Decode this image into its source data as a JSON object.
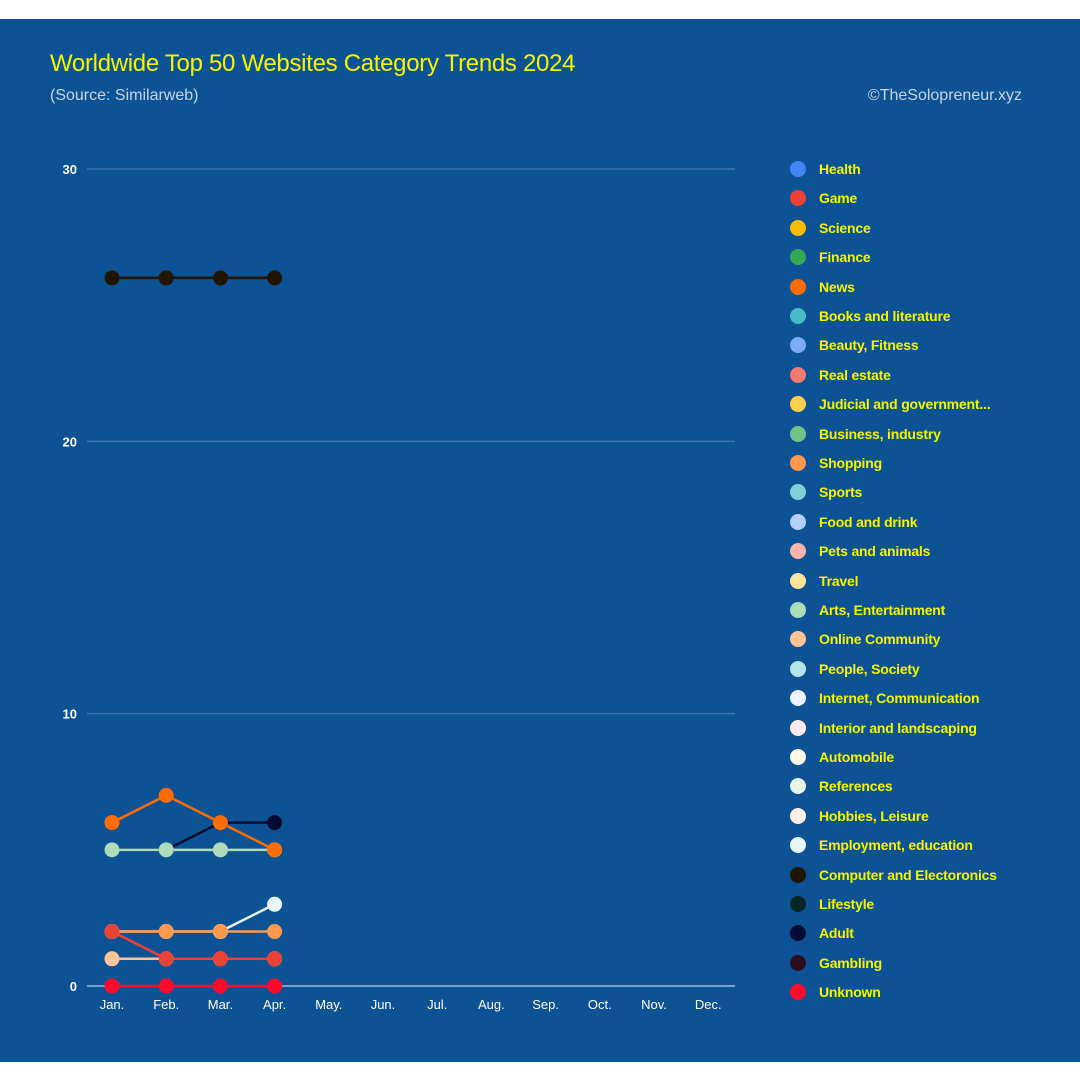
{
  "header": {
    "title": "Worldwide Top 50 Websites Category Trends 2024",
    "subtitle": "(Source: Similarweb)",
    "credit": "©TheSolopreneur.xyz"
  },
  "colors": {
    "background": "#0d5294",
    "title": "#f5f500",
    "subtitle": "#c9d6e6",
    "gridline": "#3b74ad",
    "axis": "#9fb8d6",
    "tick_label": "#ffffff"
  },
  "chart_data": {
    "type": "line",
    "title": "Worldwide Top 50 Websites Category Trends 2024",
    "subtitle": "(Source: Similarweb)",
    "xlabel": "",
    "ylabel": "",
    "x": [
      "Jan.",
      "Feb.",
      "Mar.",
      "Apr.",
      "May.",
      "Jun.",
      "Jul.",
      "Aug.",
      "Sep.",
      "Oct.",
      "Nov.",
      "Dec."
    ],
    "ylim": [
      0,
      30
    ],
    "yticks": [
      0,
      10,
      20,
      30
    ],
    "grid": true,
    "legend_position": "right",
    "series": [
      {
        "name": "Health",
        "color": "#4285f4",
        "values": []
      },
      {
        "name": "Game",
        "color": "#ea4335",
        "values": [
          2,
          1,
          1,
          1
        ]
      },
      {
        "name": "Science",
        "color": "#fbbc04",
        "values": []
      },
      {
        "name": "Finance",
        "color": "#34a853",
        "values": []
      },
      {
        "name": "News",
        "color": "#ff6d01",
        "values": [
          6,
          7,
          6,
          5
        ]
      },
      {
        "name": "Books and literature",
        "color": "#46bdc6",
        "values": []
      },
      {
        "name": "Beauty, Fitness",
        "color": "#7baaf7",
        "values": []
      },
      {
        "name": "Real estate",
        "color": "#f07b72",
        "values": []
      },
      {
        "name": "Judicial and government...",
        "color": "#fcd04f",
        "values": []
      },
      {
        "name": "Business, industry",
        "color": "#71c287",
        "values": []
      },
      {
        "name": "Shopping",
        "color": "#ff994d",
        "values": [
          2,
          2,
          2,
          2
        ]
      },
      {
        "name": "Sports",
        "color": "#7ed1d7",
        "values": []
      },
      {
        "name": "Food and drink",
        "color": "#b3cefb",
        "values": []
      },
      {
        "name": "Pets and animals",
        "color": "#f7b4ae",
        "values": []
      },
      {
        "name": "Travel",
        "color": "#fde49b",
        "values": []
      },
      {
        "name": "Arts, Entertainment",
        "color": "#aedcba",
        "values": [
          5,
          5,
          5,
          5
        ]
      },
      {
        "name": "Online Community",
        "color": "#ffc599",
        "values": [
          1,
          1,
          1,
          1
        ]
      },
      {
        "name": "People, Society",
        "color": "#b5e5e8",
        "values": []
      },
      {
        "name": "Internet, Communication",
        "color": "#ecf2fe",
        "values": []
      },
      {
        "name": "Interior and landscaping",
        "color": "#fdeceb",
        "values": []
      },
      {
        "name": "Automobile",
        "color": "#fff8e6",
        "values": []
      },
      {
        "name": "References",
        "color": "#e6f4ea",
        "values": []
      },
      {
        "name": "Hobbies, Leisure",
        "color": "#fef0e6",
        "values": []
      },
      {
        "name": "Employment, education",
        "color": "#e8f6f8",
        "values": [
          2,
          2,
          2,
          3
        ]
      },
      {
        "name": "Computer and Electoronics",
        "color": "#1f1500",
        "values": [
          26,
          26,
          26,
          26
        ]
      },
      {
        "name": "Lifestyle",
        "color": "#062626",
        "values": []
      },
      {
        "name": "Adult",
        "color": "#000c33",
        "values": [
          5,
          5,
          6,
          6
        ]
      },
      {
        "name": "Gambling",
        "color": "#2b0f1f",
        "values": []
      },
      {
        "name": "Unknown",
        "color": "#ff0a2a",
        "values": [
          0,
          0,
          0,
          0
        ]
      }
    ]
  }
}
